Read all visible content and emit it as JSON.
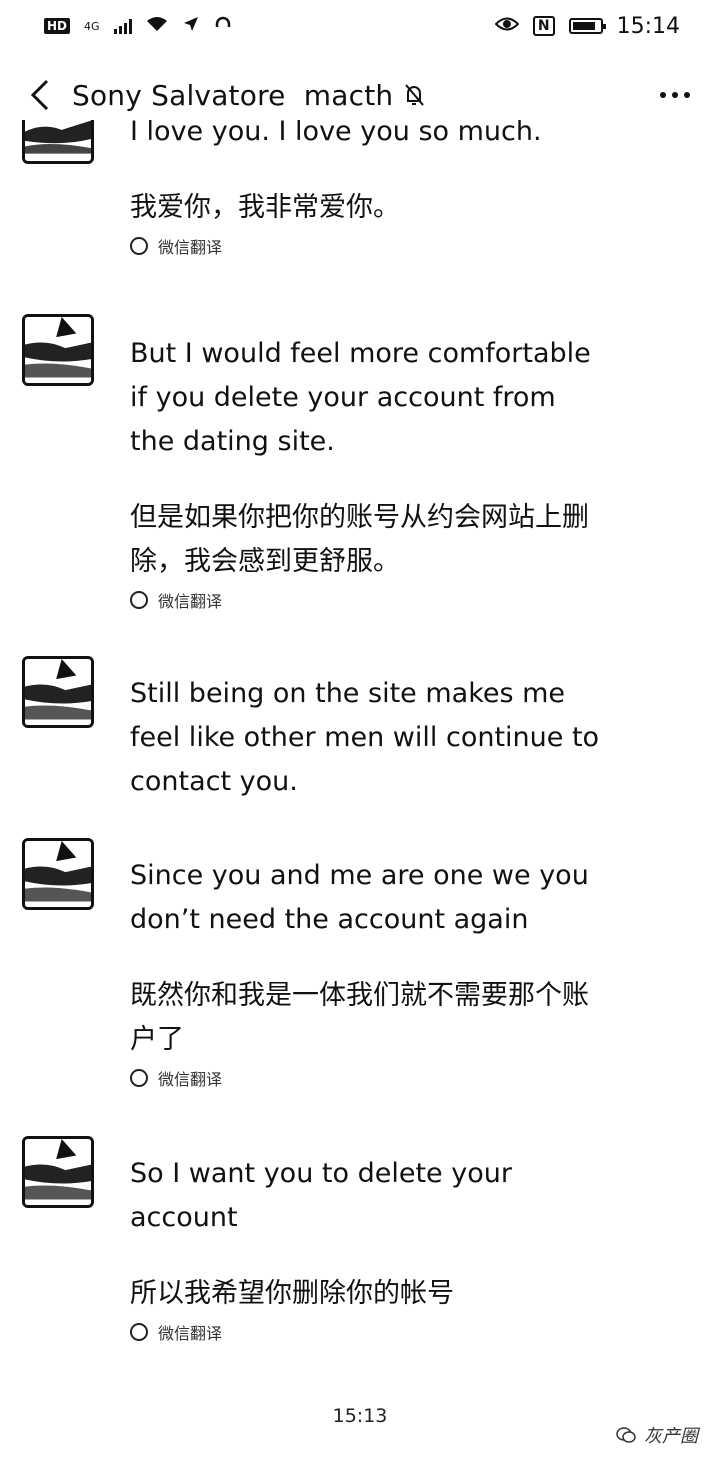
{
  "status_bar": {
    "hd_badge": "HD",
    "network": "4G",
    "time": "15:14",
    "nfc_label": "N",
    "icons": [
      "hd-badge",
      "signal-bars-icon",
      "wifi-icon",
      "location-icon",
      "headset-icon",
      "eye-icon",
      "nfc-icon",
      "battery-icon"
    ]
  },
  "header": {
    "title": "Sony Salvatore  macth",
    "icons": [
      "back-icon",
      "mute-icon",
      "more-icon"
    ]
  },
  "messages": [
    {
      "en": "I love you. I love you so much.",
      "zh": "我爱你，我非常爱你。",
      "translate_label": "微信翻译"
    },
    {
      "en": "But I would feel more comfortable if you delete your account from the dating site.",
      "zh": "但是如果你把你的账号从约会网站上删除，我会感到更舒服。",
      "translate_label": "微信翻译"
    },
    {
      "en": "Still being on the site makes me feel like other men will continue to contact you.",
      "zh": "",
      "translate_label": ""
    },
    {
      "en": "Since you and me are one we you don’t need the account again",
      "zh": "既然你和我是一体我们就不需要那个账户了",
      "translate_label": "微信翻译"
    },
    {
      "en": "So I want you to delete your account",
      "zh": "所以我希望你删除你的帐号",
      "translate_label": "微信翻译"
    }
  ],
  "timestamp": "15:13",
  "watermark": "灰产圈",
  "colors": {
    "text": "#111111",
    "background": "#ffffff"
  }
}
